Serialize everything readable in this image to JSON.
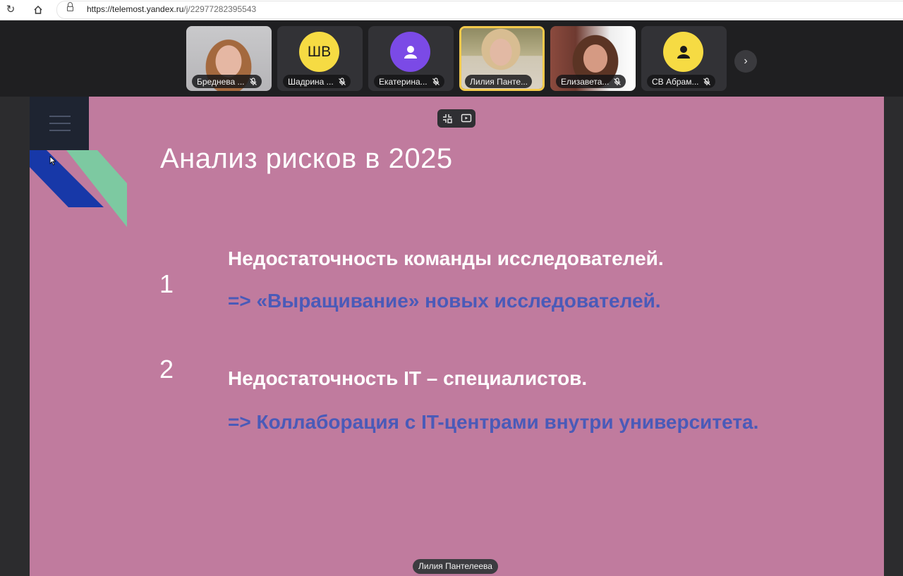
{
  "browser": {
    "url_host": "https://telemost.yandex.ru",
    "url_path": "/j/22977282395543"
  },
  "participants": [
    {
      "name": "Бреднева ...",
      "type": "video",
      "active": false
    },
    {
      "name": "Шадрина ...",
      "type": "initials",
      "initials": "ШВ",
      "color": "#f6db43"
    },
    {
      "name": "Екатерина...",
      "type": "icon",
      "color": "#7b4ae6"
    },
    {
      "name": "Лилия Панте...",
      "type": "video",
      "active": true
    },
    {
      "name": "Елизавета...",
      "type": "video",
      "active": false
    },
    {
      "name": "СВ Абрам...",
      "type": "icon",
      "color": "#f6db43"
    }
  ],
  "slide": {
    "title": "Анализ рисков в 2025",
    "items": [
      {
        "number": "1",
        "text": "Недостаточность команды исследователей.",
        "solution": "=> «Выращивание» новых исследователей."
      },
      {
        "number": "2",
        "text": "Недостаточность IT – специалистов.",
        "solution": "=> Коллаборация с IT-центрами внутри университета."
      }
    ],
    "presenter": "Лилия Пантелеева",
    "colors": {
      "background": "#c07b9e",
      "accent_blue": "#1738a8",
      "accent_green": "#7dc9a1",
      "solution_text": "#4a5ab8"
    }
  }
}
